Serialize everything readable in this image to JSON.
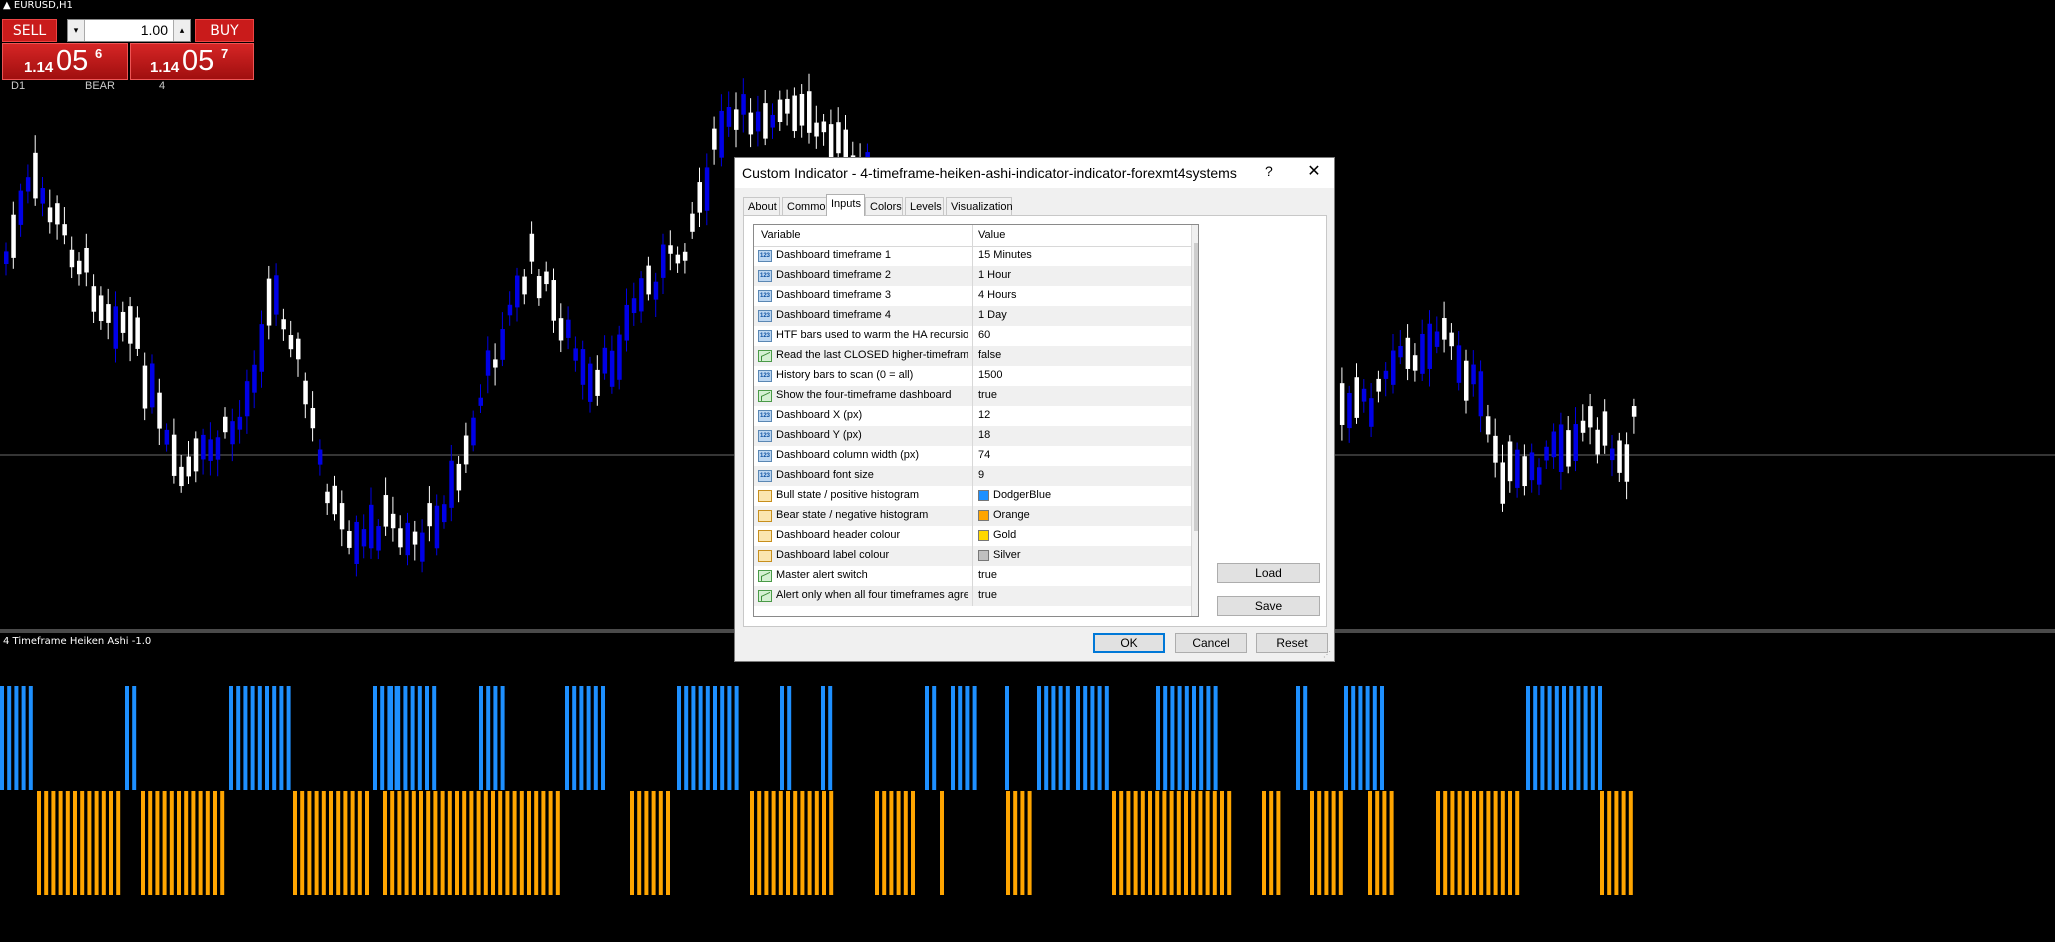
{
  "symbol_label": "EURUSD,H1",
  "trade_panel": {
    "sell_label": "SELL",
    "buy_label": "BUY",
    "lot_value": "1.00",
    "lot_down_glyph": "▾",
    "lot_up_glyph": "▴",
    "bid": {
      "prefix": "1.14",
      "big": "05",
      "sup": "6"
    },
    "ask": {
      "prefix": "1.14",
      "big": "05",
      "sup": "7"
    }
  },
  "dashboard_labels": [
    "D1",
    "BEAR",
    "4"
  ],
  "subwindow_title": "4 Timeframe Heiken Ashi -1.0",
  "dialog": {
    "title": "Custom Indicator - 4-timeframe-heiken-ashi-indicator-indicator-forexmt4systems",
    "help_glyph": "?",
    "close_glyph": "✕",
    "tabs": [
      "About",
      "Common",
      "Inputs",
      "Colors",
      "Levels",
      "Visualization"
    ],
    "active_tab": "Inputs",
    "columns": [
      "Variable",
      "Value"
    ],
    "rows": [
      {
        "type": "int",
        "name": "Dashboard timeframe 1",
        "value": "15 Minutes"
      },
      {
        "type": "int",
        "name": "Dashboard timeframe 2",
        "value": "1 Hour"
      },
      {
        "type": "int",
        "name": "Dashboard timeframe 3",
        "value": "4 Hours"
      },
      {
        "type": "int",
        "name": "Dashboard timeframe 4",
        "value": "1 Day"
      },
      {
        "type": "int",
        "name": "HTF bars used to warm the HA recursion",
        "value": "60"
      },
      {
        "type": "bool",
        "name": "Read the last CLOSED higher-timeframe...",
        "value": "false"
      },
      {
        "type": "int",
        "name": "History bars to scan (0 = all)",
        "value": "1500"
      },
      {
        "type": "bool",
        "name": "Show the four-timeframe dashboard",
        "value": "true"
      },
      {
        "type": "int",
        "name": "Dashboard X (px)",
        "value": "12"
      },
      {
        "type": "int",
        "name": "Dashboard Y (px)",
        "value": "18"
      },
      {
        "type": "int",
        "name": "Dashboard column width (px)",
        "value": "74"
      },
      {
        "type": "int",
        "name": "Dashboard font size",
        "value": "9"
      },
      {
        "type": "color",
        "name": "Bull state / positive histogram",
        "value": "DodgerBlue",
        "swatch": "#1e90ff"
      },
      {
        "type": "color",
        "name": "Bear state / negative histogram",
        "value": "Orange",
        "swatch": "#ffa500"
      },
      {
        "type": "color",
        "name": "Dashboard header colour",
        "value": "Gold",
        "swatch": "#ffd700"
      },
      {
        "type": "color",
        "name": "Dashboard label colour",
        "value": "Silver",
        "swatch": "#c0c0c0"
      },
      {
        "type": "bool",
        "name": "Master alert switch",
        "value": "true"
      },
      {
        "type": "bool",
        "name": "Alert only when all four timeframes agree",
        "value": "true"
      }
    ],
    "int_icon_text": "123",
    "load_label": "Load",
    "save_label": "Save",
    "ok_label": "OK",
    "cancel_label": "Cancel",
    "reset_label": "Reset"
  },
  "colors": {
    "bull_candle": "#0000e6",
    "bear_candle": "#ffffff",
    "hist_positive": "#1e90ff",
    "hist_negative": "#ffa500",
    "sell_buy_red": "#c91b1b"
  }
}
